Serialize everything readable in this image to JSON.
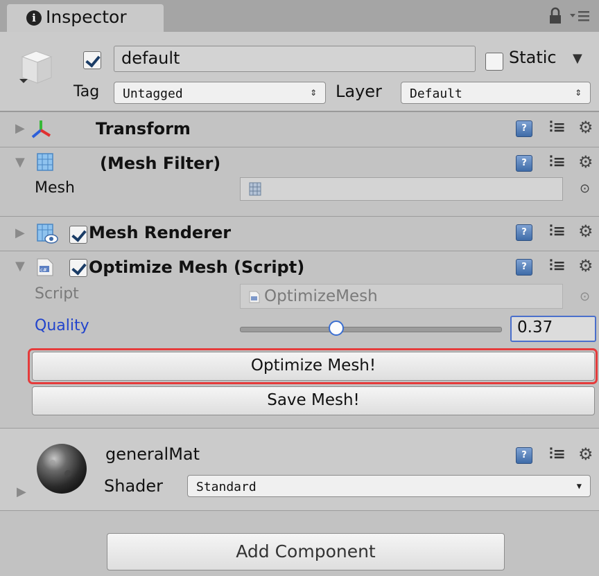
{
  "tab": {
    "title": "Inspector",
    "lock_icon": "lock-icon",
    "menu_icon": "menu-icon"
  },
  "header": {
    "active": true,
    "object_name": "default",
    "static_label": "Static",
    "tag_label": "Tag",
    "tag_value": "Untagged",
    "layer_label": "Layer",
    "layer_value": "Default"
  },
  "components": {
    "transform": {
      "title": "Transform",
      "expanded": false
    },
    "mesh_filter": {
      "title": "(Mesh Filter)",
      "expanded": true,
      "mesh_label": "Mesh",
      "mesh_value": ""
    },
    "mesh_renderer": {
      "title": "Mesh Renderer",
      "expanded": false,
      "enabled": true
    },
    "optimize_mesh": {
      "title": "Optimize Mesh (Script)",
      "expanded": true,
      "enabled": true,
      "script_label": "Script",
      "script_value": "OptimizeMesh",
      "quality_label": "Quality",
      "quality_value": "0.37",
      "quality_fraction": 0.37,
      "optimize_button": "Optimize Mesh!",
      "save_button": "Save Mesh!"
    }
  },
  "material": {
    "name": "generalMat",
    "shader_label": "Shader",
    "shader_value": "Standard"
  },
  "footer": {
    "add_component": "Add Component"
  },
  "colors": {
    "highlight": "#e53b3b",
    "quality_label": "#2244cc",
    "field_focus": "#4a6fcc"
  }
}
